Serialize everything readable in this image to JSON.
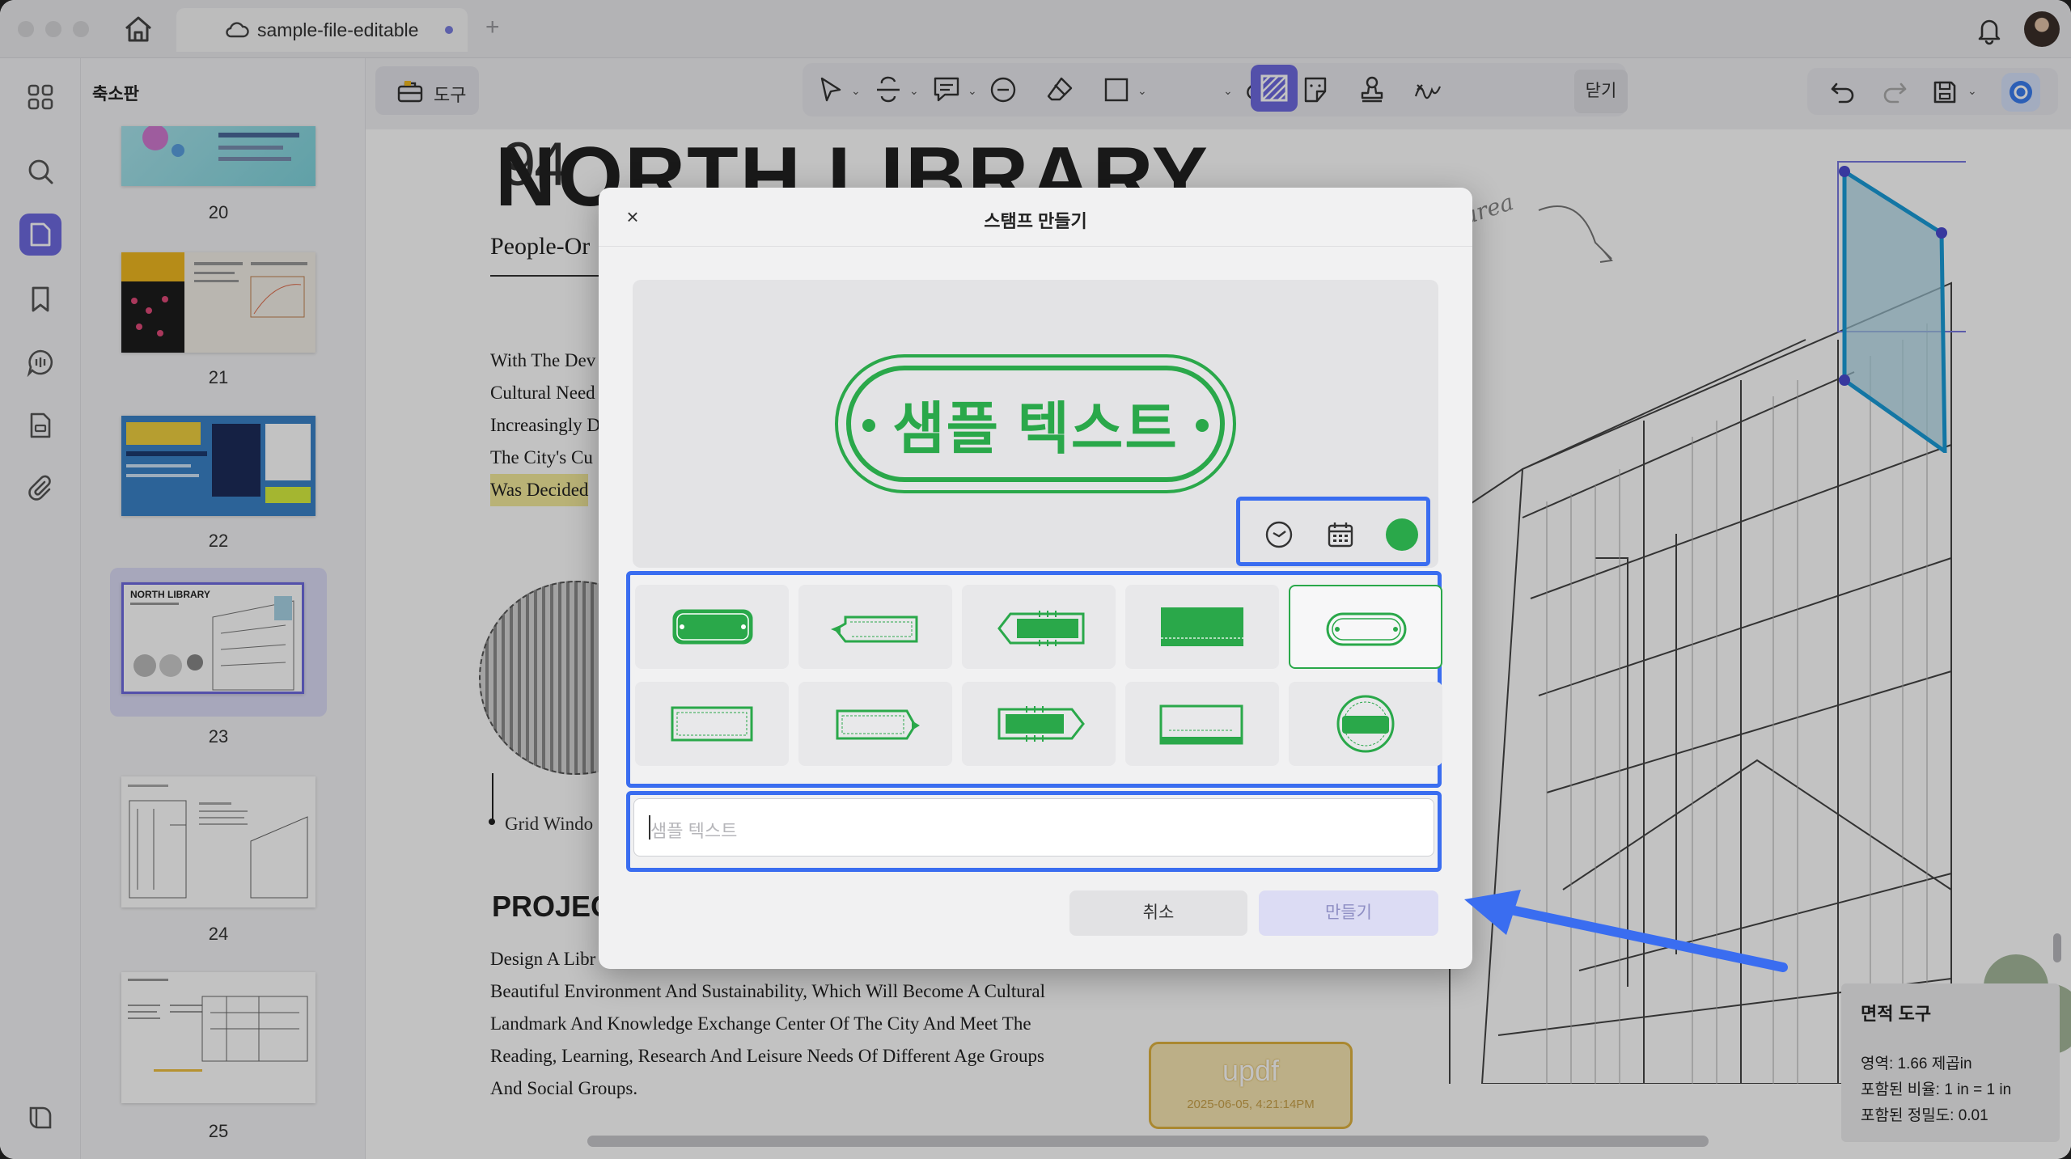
{
  "titlebar": {
    "tab_title": "sample-file-editable",
    "new_tab": "+"
  },
  "sidebar": {
    "title": "축소판",
    "pages": [
      "20",
      "21",
      "22",
      "23",
      "24",
      "25"
    ],
    "selected_page": "23"
  },
  "toolbar": {
    "tools_label": "도구",
    "close_label": "닫기"
  },
  "document": {
    "page_number": "94",
    "title": "NORTH LIBRARY",
    "subtitle": "People-Or",
    "paragraph_lines": [
      "With The Dev",
      "Cultural Need",
      "Increasingly D",
      "The City's Cu",
      "Was Decided"
    ],
    "caption": "Grid Windo",
    "section_heading": "PROJEC",
    "body_lines": [
      "Design A Libr",
      "Beautiful Environment And Sustainability, Which Will Become A Cultural",
      "Landmark And Knowledge Exchange Center Of The City And Meet The",
      "Reading, Learning, Research And Leisure Needs Of Different Age Groups",
      "And Social Groups."
    ],
    "handwritten_note": "area",
    "stamp": {
      "label": "updf",
      "date": "2025-06-05, 4:21:14PM"
    }
  },
  "measure_panel": {
    "title": "면적 도구",
    "area": "영역: 1.66 제곱in",
    "scale": "포함된 비율: 1 in = 1 in",
    "precision": "포함된 정밀도: 0.01"
  },
  "dialog": {
    "title": "스탬프 만들기",
    "close": "×",
    "preview_text": "샘플 텍스트",
    "stamp_color": "#2aa84a",
    "text_placeholder": "샘플 텍스트",
    "cancel_label": "취소",
    "create_label": "만들기"
  },
  "colors": {
    "accent": "#6e6ae0",
    "highlight_box": "#3a6df0",
    "stamp_green": "#2aa84a"
  }
}
